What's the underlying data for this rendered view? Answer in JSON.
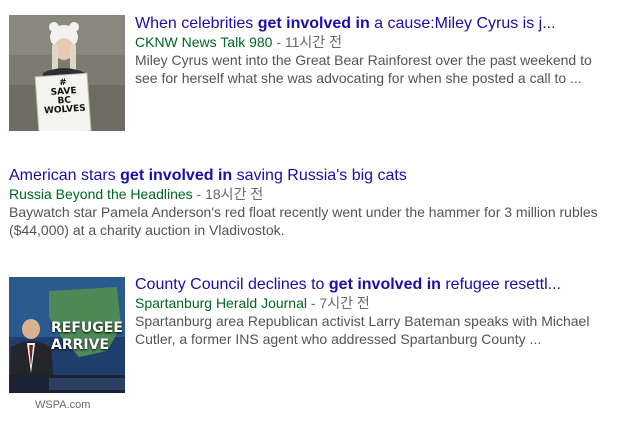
{
  "results": [
    {
      "title_pre": "When celebrities ",
      "title_bold": "get involved in",
      "title_post": " a cause:Miley Cyrus is j...",
      "source": "CKNW News Talk 980",
      "time": " - 11시간 전",
      "snippet": "Miley Cyrus went into the Great Bear Rainforest over the past weekend to see for herself what she was advocating for when she posted a call to ...",
      "sign_text": [
        "#",
        "SAVE",
        "BC",
        "WOLVES"
      ]
    },
    {
      "title_pre": "American stars ",
      "title_bold": "get involved in",
      "title_post": " saving Russia's big cats",
      "source": "Russia Beyond the Headlines",
      "time": " - 18시간 전",
      "snippet": "Baywatch star Pamela Anderson's red float recently went under the hammer for 3 million rubles ($44,000) at a charity auction in Vladivostok."
    },
    {
      "title_pre": "County Council declines to ",
      "title_bold": "get involved in",
      "title_post": " refugee resettl...",
      "source": "Spartanburg Herald Journal",
      "time": " - 7시간 전",
      "snippet": "Spartanburg area Republican activist Larry Bateman speaks with Michael Cutler, a former INS agent who addressed Spartanburg County ...",
      "thumb_caption": "WSPA.com",
      "thumb_text": [
        "REFUGEE",
        "ARRIVE"
      ]
    }
  ]
}
